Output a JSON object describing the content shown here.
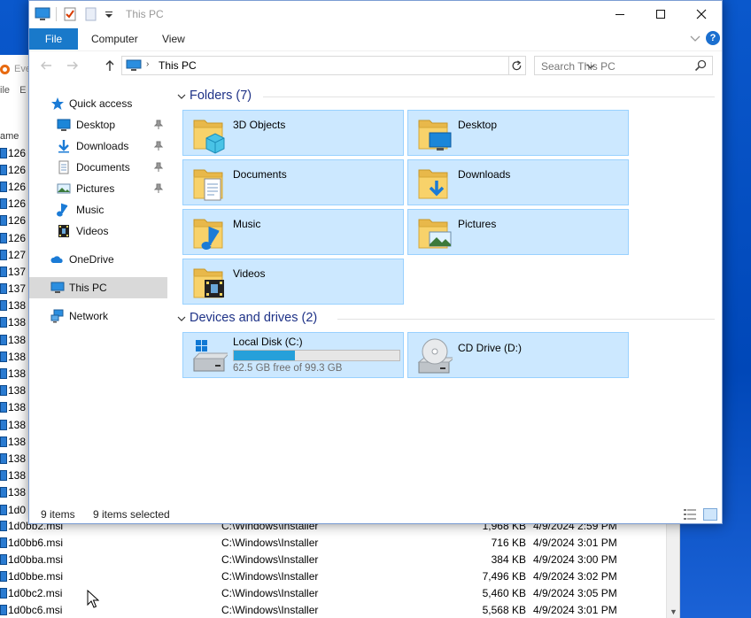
{
  "window": {
    "title": "This PC"
  },
  "ribbon": {
    "tabs": [
      "File",
      "Computer",
      "View"
    ]
  },
  "address": {
    "location": "This PC",
    "search_placeholder": "Search This PC"
  },
  "nav_pane": [
    {
      "label": "Quick access",
      "icon": "star-icon",
      "level": "top"
    },
    {
      "label": "Desktop",
      "icon": "desktop-folder-icon",
      "level": "sub",
      "pinned": true
    },
    {
      "label": "Downloads",
      "icon": "downloads-folder-icon",
      "level": "sub",
      "pinned": true
    },
    {
      "label": "Documents",
      "icon": "documents-folder-icon",
      "level": "sub",
      "pinned": true
    },
    {
      "label": "Pictures",
      "icon": "pictures-folder-icon",
      "level": "sub",
      "pinned": true
    },
    {
      "label": "Music",
      "icon": "music-folder-icon",
      "level": "sub"
    },
    {
      "label": "Videos",
      "icon": "videos-folder-icon",
      "level": "sub"
    },
    {
      "label": "OneDrive",
      "icon": "onedrive-cloud-icon",
      "level": "top"
    },
    {
      "label": "This PC",
      "icon": "this-pc-icon",
      "level": "top",
      "selected": true
    },
    {
      "label": "Network",
      "icon": "network-icon",
      "level": "top"
    }
  ],
  "folders": {
    "header": "Folders (7)",
    "items": [
      "3D Objects",
      "Desktop",
      "Documents",
      "Downloads",
      "Music",
      "Pictures",
      "Videos"
    ]
  },
  "drives": {
    "header": "Devices and drives (2)",
    "items": [
      {
        "name": "Local Disk (C:)",
        "free_text": "62.5 GB free of 99.3 GB",
        "used_fraction": 0.37
      },
      {
        "name": "CD Drive (D:)"
      }
    ]
  },
  "status": {
    "count": "9 items",
    "selected": "9 items selected"
  },
  "background_window": {
    "toolbar_partial": "ile",
    "toolbar_partial2": "E",
    "app_partial": "Eve",
    "column_partial": "ame",
    "left_partial_names": [
      "126",
      "126",
      "126",
      "126",
      "126",
      "126",
      "127",
      "137",
      "137",
      "138",
      "138",
      "138",
      "138",
      "138",
      "138",
      "138",
      "138",
      "138",
      "138",
      "138",
      "138",
      "1d0"
    ],
    "rows": [
      {
        "name": "1d0bb2.msi",
        "path": "C:\\Windows\\Installer",
        "size": "1,968 KB",
        "date": "4/9/2024 2:59 PM"
      },
      {
        "name": "1d0bb6.msi",
        "path": "C:\\Windows\\Installer",
        "size": "716 KB",
        "date": "4/9/2024 3:01 PM"
      },
      {
        "name": "1d0bba.msi",
        "path": "C:\\Windows\\Installer",
        "size": "384 KB",
        "date": "4/9/2024 3:00 PM"
      },
      {
        "name": "1d0bbe.msi",
        "path": "C:\\Windows\\Installer",
        "size": "7,496 KB",
        "date": "4/9/2024 3:02 PM"
      },
      {
        "name": "1d0bc2.msi",
        "path": "C:\\Windows\\Installer",
        "size": "5,460 KB",
        "date": "4/9/2024 3:05 PM"
      },
      {
        "name": "1d0bc6.msi",
        "path": "C:\\Windows\\Installer",
        "size": "5,568 KB",
        "date": "4/9/2024 3:01 PM"
      }
    ]
  },
  "colors": {
    "accent": "#1979ca",
    "selection": "#cce8ff",
    "selection_border": "#99d1ff",
    "group_header": "#1e3287",
    "drive_bar": "#26a0da"
  }
}
